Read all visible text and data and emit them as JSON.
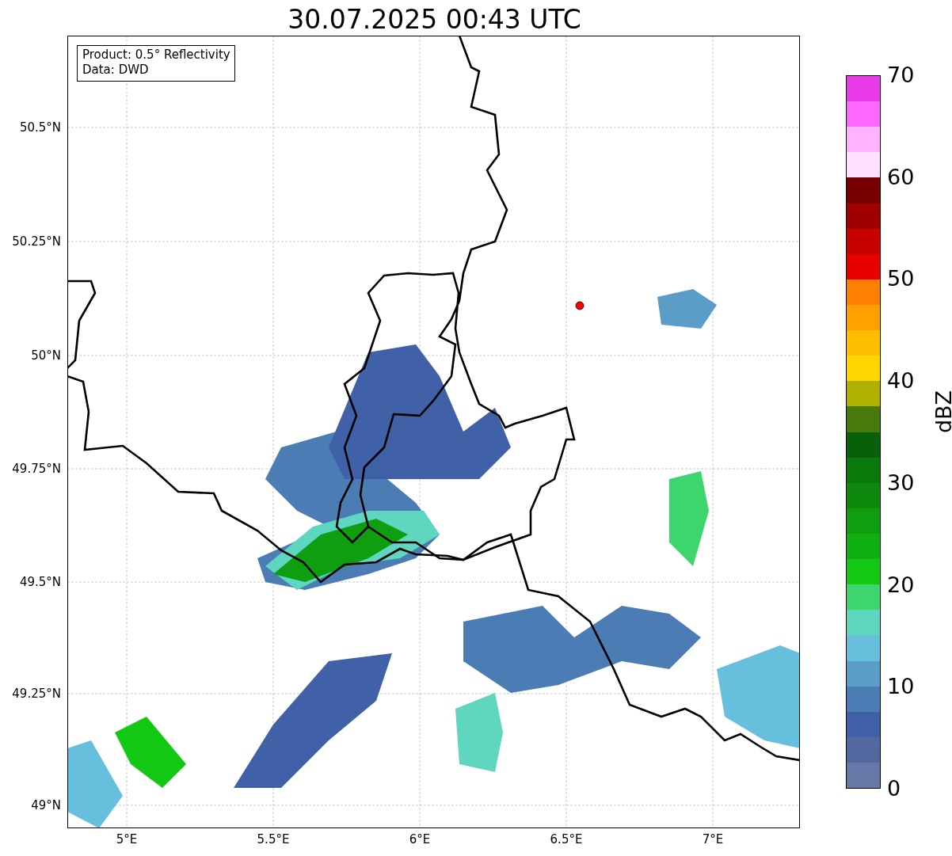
{
  "title": "30.07.2025 00:43 UTC",
  "legend": [
    "Product: 0.5° Reflectivity",
    "Data: DWD"
  ],
  "y_ticks": [
    "50.5°N",
    "50.25°N",
    "50°N",
    "49.75°N",
    "49.5°N",
    "49.25°N",
    "49°N"
  ],
  "x_ticks": [
    "5°E",
    "5.5°E",
    "6°E",
    "6.5°E",
    "7°E"
  ],
  "colorbar": {
    "label": "dBZ",
    "ticks": [
      "70",
      "60",
      "50",
      "40",
      "30",
      "20",
      "10",
      "0"
    ],
    "bands": [
      {
        "color": "#e83ae8"
      },
      {
        "color": "#ff66ff"
      },
      {
        "color": "#ffb3ff"
      },
      {
        "color": "#ffe0ff"
      },
      {
        "color": "#780000"
      },
      {
        "color": "#a00000"
      },
      {
        "color": "#c80000"
      },
      {
        "color": "#e60000"
      },
      {
        "color": "#ff7f00"
      },
      {
        "color": "#ff9f00"
      },
      {
        "color": "#ffbf00"
      },
      {
        "color": "#ffd700"
      },
      {
        "color": "#b0b000"
      },
      {
        "color": "#467a0a"
      },
      {
        "color": "#0a5f0a"
      },
      {
        "color": "#0b780b"
      },
      {
        "color": "#0d8a0d"
      },
      {
        "color": "#0f9e0f"
      },
      {
        "color": "#10b010"
      },
      {
        "color": "#12c812"
      },
      {
        "color": "#3dd66e"
      },
      {
        "color": "#5fd6c0"
      },
      {
        "color": "#66bfdc"
      },
      {
        "color": "#5a9ec8"
      },
      {
        "color": "#4b7cb4"
      },
      {
        "color": "#4060a8"
      },
      {
        "color": "#5468a0"
      },
      {
        "color": "#6678a8"
      }
    ]
  }
}
